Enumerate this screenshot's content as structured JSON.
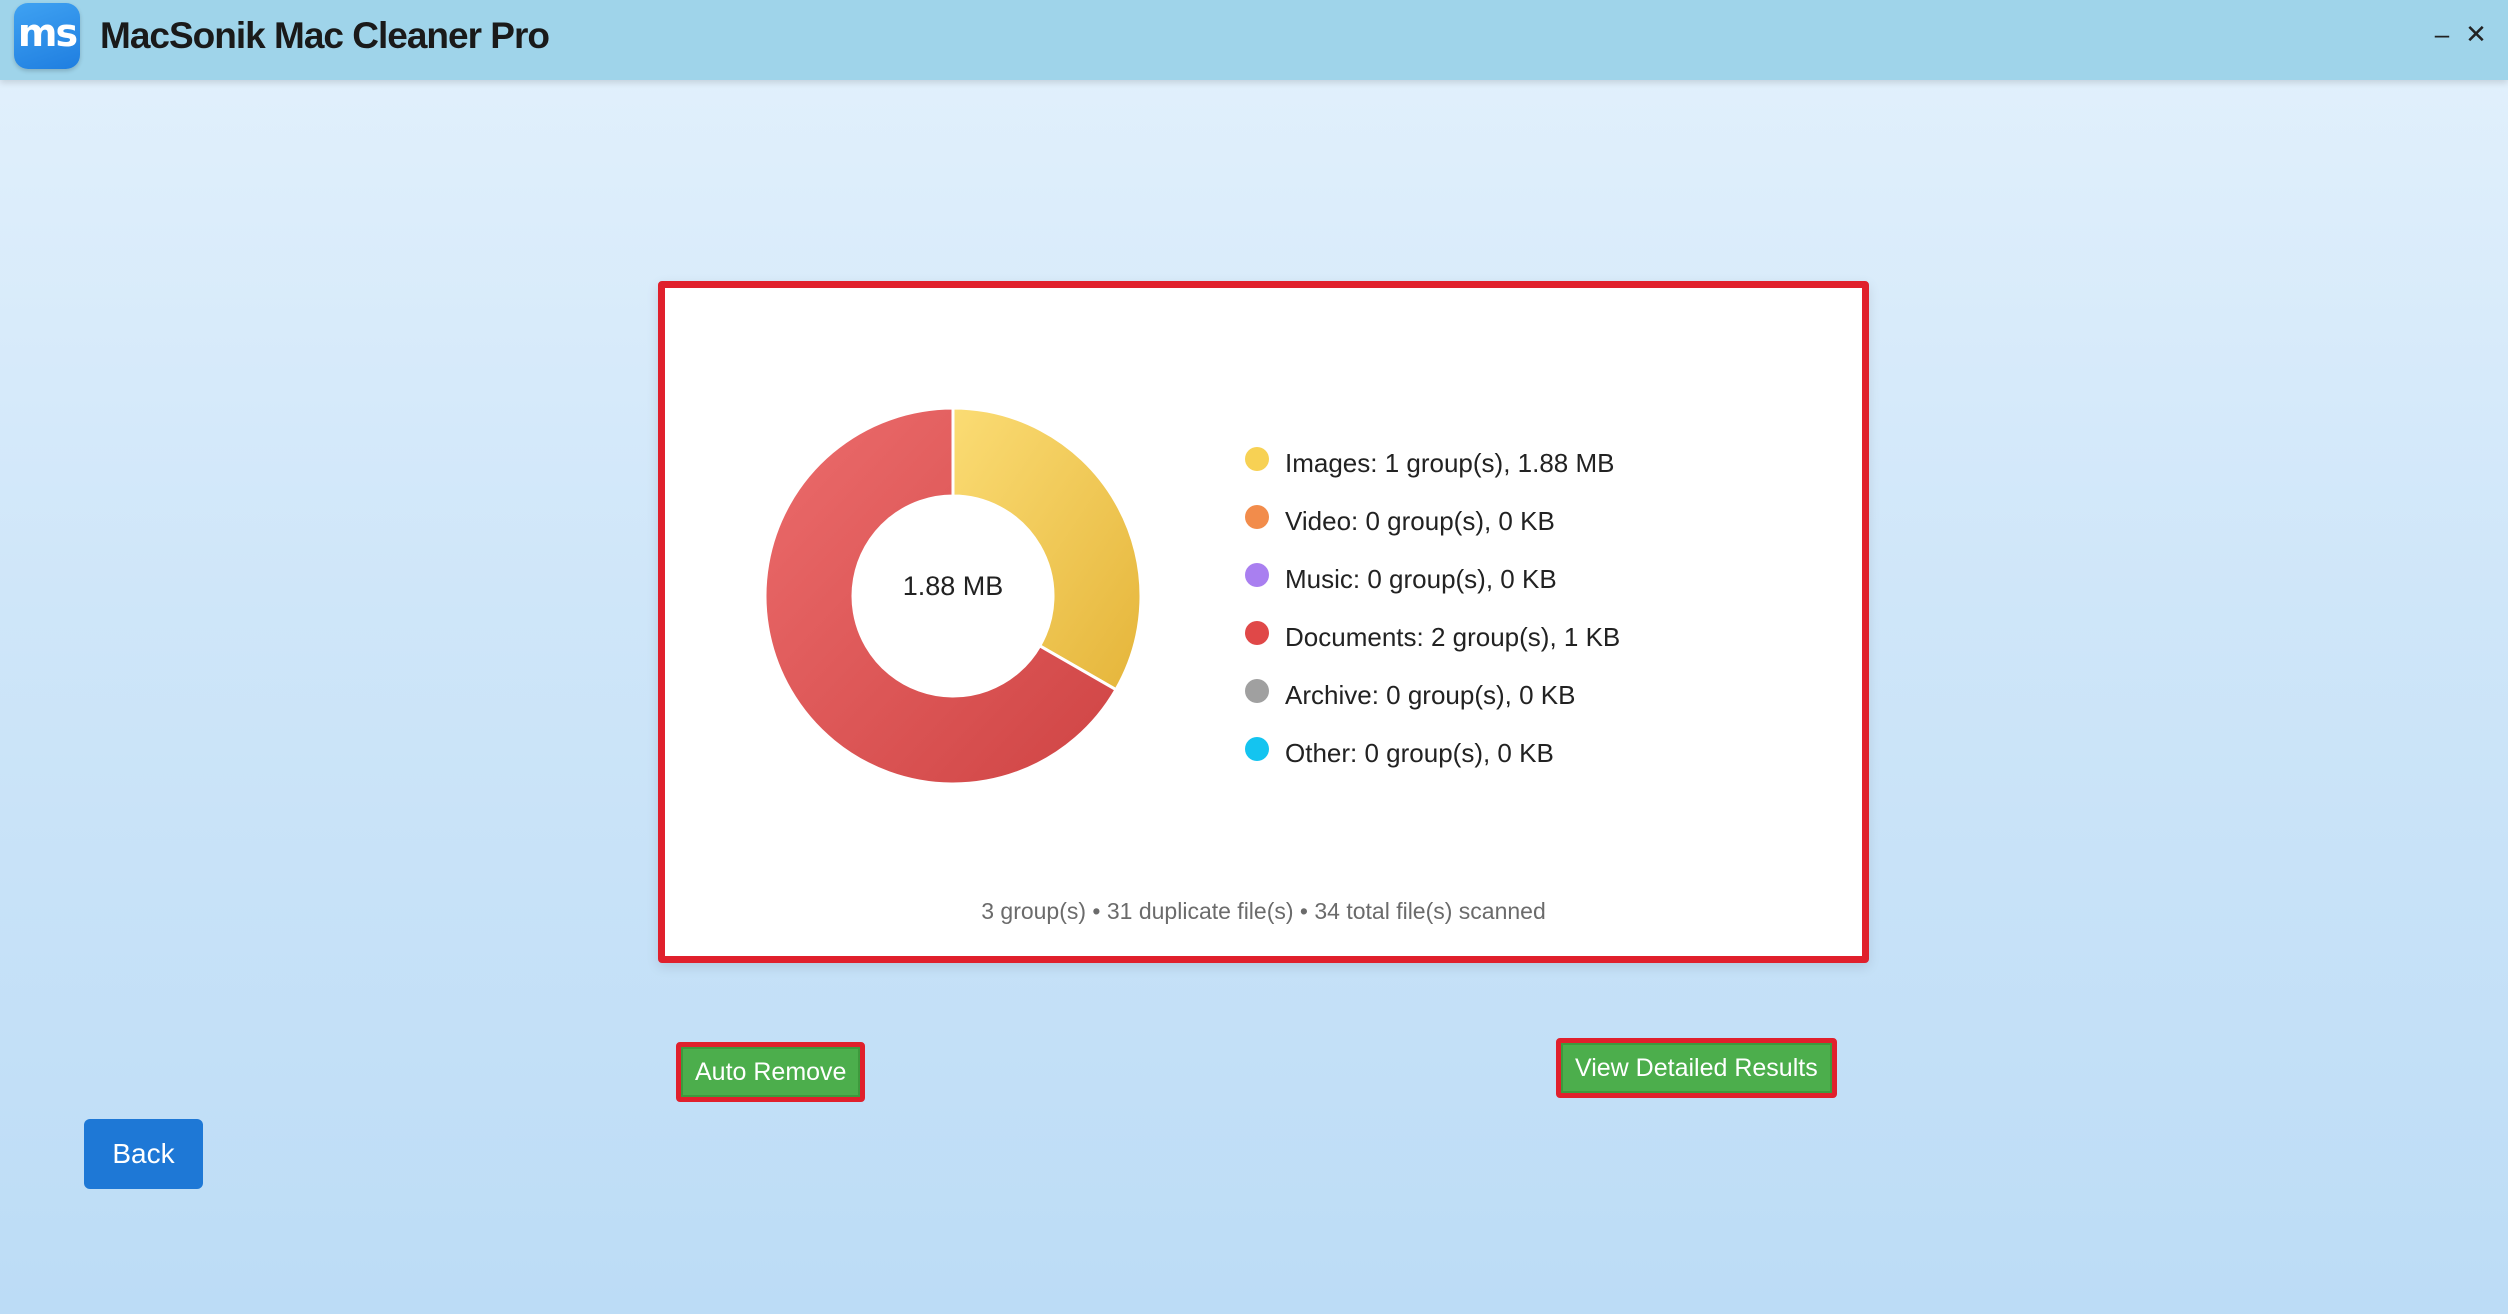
{
  "app": {
    "logo_text": "ms",
    "title": "MacSonik Mac Cleaner Pro",
    "minimize_label": "–",
    "close_label": "✕"
  },
  "chart_data": {
    "type": "pie",
    "center_label": "1.88 MB",
    "slices": [
      {
        "label": "Images",
        "value": 33.3,
        "color": "#f2c94c"
      },
      {
        "label": "Documents",
        "value": 66.7,
        "color": "#e05555"
      }
    ]
  },
  "legend": [
    {
      "text": "Images: 1 group(s), 1.88 MB",
      "color": "#f7d154"
    },
    {
      "text": "Video: 0 group(s), 0 KB",
      "color": "#f28c4b"
    },
    {
      "text": "Music: 0 group(s), 0 KB",
      "color": "#a97ff0"
    },
    {
      "text": "Documents: 2 group(s), 1 KB",
      "color": "#e04848"
    },
    {
      "text": "Archive: 0 group(s), 0 KB",
      "color": "#a0a0a0"
    },
    {
      "text": "Other: 0 group(s), 0 KB",
      "color": "#14c4f0"
    }
  ],
  "summary": "3 group(s) • 31 duplicate file(s) • 34 total file(s) scanned",
  "buttons": {
    "auto_remove": "Auto Remove",
    "view_details": "View Detailed Results",
    "back": "Back"
  }
}
